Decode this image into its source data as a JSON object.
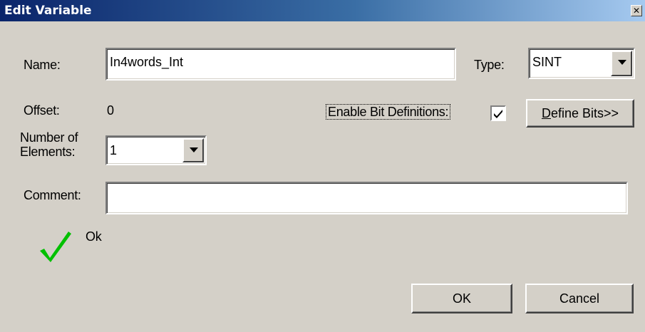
{
  "window": {
    "title": "Edit Variable",
    "close_glyph": "✕"
  },
  "name": {
    "label": "Name:",
    "value": "In4words_Int"
  },
  "type": {
    "label": "Type:",
    "value": "SINT"
  },
  "offset": {
    "label": "Offset:",
    "value": "0"
  },
  "bits": {
    "checkbox_label": "Enable Bit Definitions:",
    "checked": true,
    "define_button_mnemonic": "D",
    "define_button_rest": "efine Bits>>"
  },
  "elements": {
    "label_line1": "Number of",
    "label_line2": "Elements:",
    "value": "1"
  },
  "comment": {
    "label": "Comment:",
    "value": ""
  },
  "status": {
    "icon": "green-checkmark-icon",
    "icon_color": "#00c000",
    "text": "Ok"
  },
  "buttons": {
    "ok": "OK",
    "cancel": "Cancel"
  }
}
